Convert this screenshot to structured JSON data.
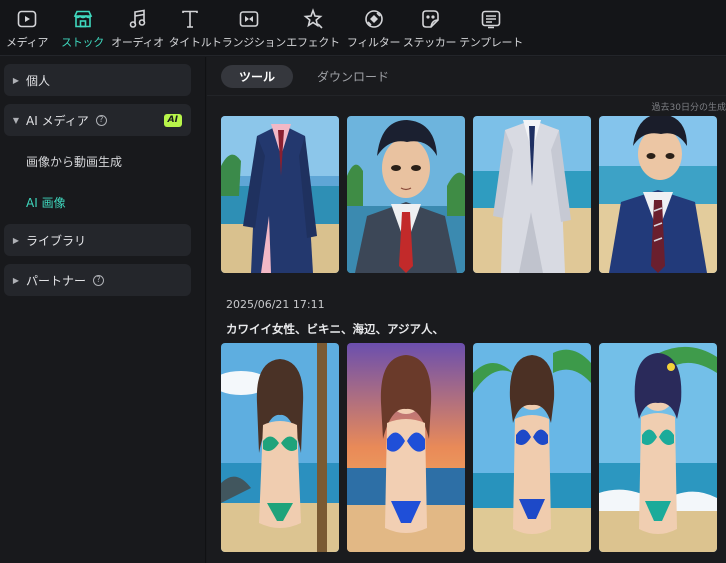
{
  "toolbar": {
    "items": [
      {
        "label": "メディア",
        "icon": "media-icon"
      },
      {
        "label": "ストック",
        "icon": "stock-icon"
      },
      {
        "label": "オーディオ",
        "icon": "audio-icon"
      },
      {
        "label": "タイトル",
        "icon": "title-icon"
      },
      {
        "label": "トランジション",
        "icon": "transition-icon"
      },
      {
        "label": "エフェクト",
        "icon": "effect-icon"
      },
      {
        "label": "フィルター",
        "icon": "filter-icon"
      },
      {
        "label": "ステッカー",
        "icon": "sticker-icon"
      },
      {
        "label": "テンプレート",
        "icon": "template-icon"
      }
    ],
    "active": "ストック",
    "accent_color": "#3fd8be"
  },
  "sidebar": {
    "personal": "個人",
    "ai_media": "AI メディア",
    "ai_badge": "AI",
    "ai_sub": [
      "画像から動画生成",
      "AI 画像"
    ],
    "ai_sub_active": "AI 画像",
    "library": "ライブラリ",
    "partner": "パートナー",
    "badge_color": "#b8f54a"
  },
  "content": {
    "tabs": [
      "ツール",
      "ダウンロード"
    ],
    "active_tab": "ツール",
    "note": "過去30日分の生成",
    "timestamp": "2025/06/21 17:11",
    "prompt": "カワイイ女性、ビキニ、海辺、アジア人、"
  },
  "gallery": {
    "row1": [
      "man-pink-shirt-blue-suit",
      "man-closeup-gray-suit",
      "man-white-suit",
      "man-navy-suit-beach"
    ],
    "row2": [
      "woman-green-bikini",
      "woman-blue-bikini-sunset",
      "woman-blue-bikini-palm",
      "woman-teal-bikini-flower"
    ]
  }
}
